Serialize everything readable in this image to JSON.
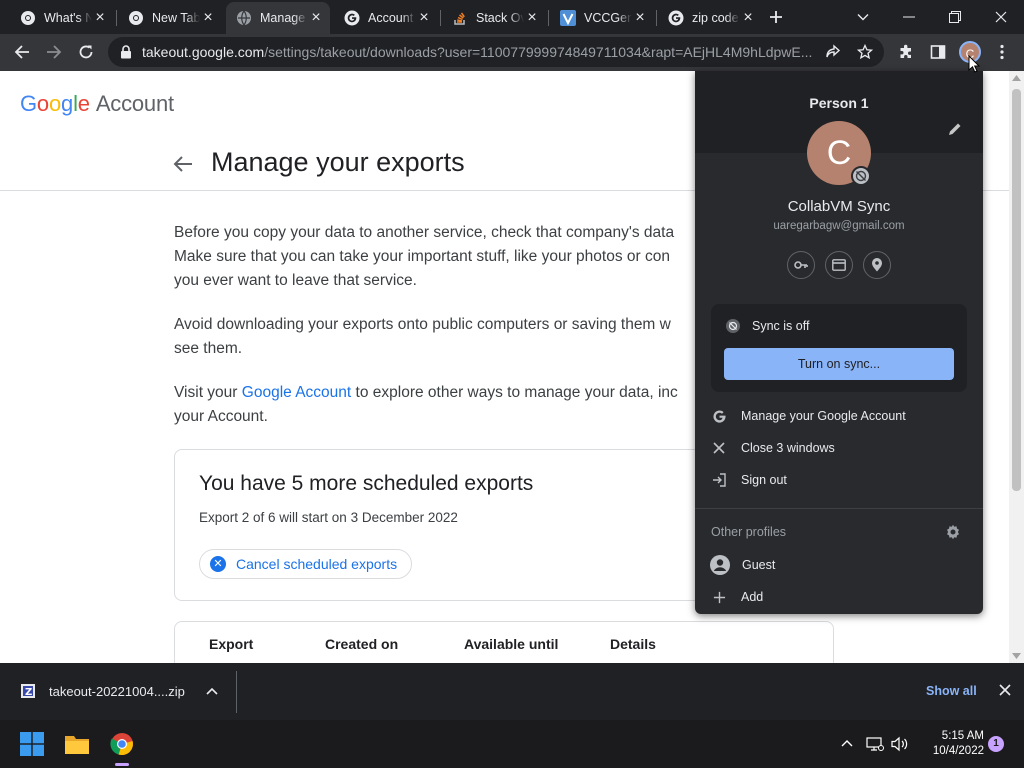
{
  "browser": {
    "tabs": [
      {
        "label": "What's New",
        "icon": "chrome-icon"
      },
      {
        "label": "New Tab",
        "icon": "chrome-icon"
      },
      {
        "label": "Manage your exports",
        "icon": "globe-icon",
        "active": true
      },
      {
        "label": "Account",
        "icon": "google-icon"
      },
      {
        "label": "Stack Overflow",
        "icon": "stackoverflow-icon"
      },
      {
        "label": "VCCGenerator",
        "icon": "vcc-icon"
      },
      {
        "label": "zip code",
        "icon": "google-icon"
      }
    ],
    "new_tab_icon": "plus-icon",
    "url_host": "takeout.google.com",
    "url_path": "/settings/takeout/downloads?user=110077999974849711034&rapt=AEjHL4M9hLdpwE..."
  },
  "page": {
    "logo_google": "Google",
    "logo_account": "Account",
    "title": "Manage your exports",
    "p1_line1": "Before you copy your data to another service, check that company's data",
    "p1_line2": "Make sure that you can take your important stuff, like your photos or con",
    "p1_line3": "you ever want to leave that service.",
    "p2_line1": "Avoid downloading your exports onto public computers or saving them w",
    "p2_line2": "see them.",
    "p3_pre": "Visit your ",
    "p3_link": "Google Account",
    "p3_post": " to explore other ways to manage your data, inc",
    "p3_line2": "your Account.",
    "scheduled_title": "You have 5 more scheduled exports",
    "scheduled_sub": "Export 2 of 6 will start on 3 December 2022",
    "cancel_label": "Cancel scheduled exports",
    "table_headers": [
      "Export",
      "Created on",
      "Available until",
      "Details"
    ]
  },
  "profile": {
    "header": "Person 1",
    "avatar_letter": "C",
    "sync_name": "CollabVM Sync",
    "email": "uaregarbagw@gmail.com",
    "sync_status": "Sync is off",
    "sync_button": "Turn on sync...",
    "menu": [
      "Manage your Google Account",
      "Close 3 windows",
      "Sign out"
    ],
    "other_profiles_label": "Other profiles",
    "others": [
      "Guest",
      "Add"
    ]
  },
  "downloads": {
    "filename": "takeout-20221004....zip",
    "show_all": "Show all"
  },
  "taskbar": {
    "time": "5:15 AM",
    "date": "10/4/2022",
    "notifications": "1"
  },
  "colors": {
    "accent_blue": "#1a73e8",
    "sync_button": "#8ab4f8",
    "avatar": "#b5826f",
    "chrome_dark": "#202124"
  }
}
